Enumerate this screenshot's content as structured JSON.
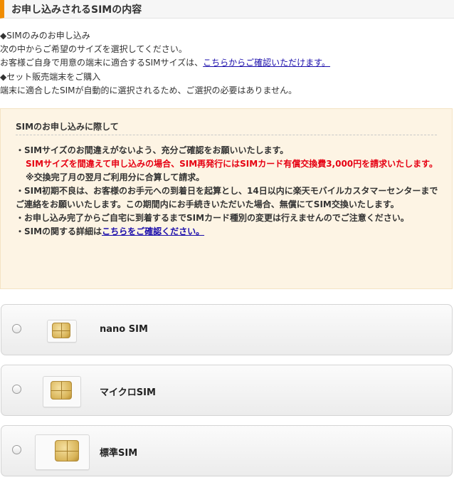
{
  "section_title": "お申し込みされるSIMの内容",
  "intro": {
    "line1": "◆SIMのみのお申し込み",
    "line2": "次の中からご希望のサイズを選択してください。",
    "line3_text": "お客様ご自身で用意の端末に適合するSIMサイズは、",
    "line3_link": "こちらからご確認いただけます。",
    "line4": "◆セット販売端末をご購入",
    "line5": "端末に適合したSIMが自動的に選択されるため、ご選択の必要はありません。"
  },
  "notice": {
    "title": "SIMのお申し込みに際して",
    "item1": "・SIMサイズのお間違えがないよう、充分ご確認をお願いいたします。",
    "item1_red": "SIMサイズを間違えて申し込みの場合、SIM再発行にはSIMカード有償交換費3,000円を請求いたします。",
    "item1_note": "※交換完了月の翌月ご利用分に合算して請求。",
    "item2": "・SIM初期不良は、お客様のお手元への到着日を起算とし、14日以内に楽天モバイルカスタマーセンターまでご連絡をお願いいたします。この期間内にお手続きいただいた場合、無償にてSIM交換いたします。",
    "item3": "・お申し込み完了からご自宅に到着するまでSIMカード種別の変更は行えませんのでご注意ください。",
    "item4_text": "・SIMの関する詳細は",
    "item4_link": "こちらをご確認ください。"
  },
  "options": [
    {
      "label": "nano SIM",
      "icon": "nano-sim-card-icon"
    },
    {
      "label": "マイクロSIM",
      "icon": "micro-sim-card-icon"
    },
    {
      "label": "標準SIM",
      "icon": "standard-sim-card-icon"
    }
  ],
  "colors": {
    "accent_bar": "#f08c00",
    "notice_bg": "#fdf4e4",
    "warning_red": "#e60012",
    "link": "#1a0dab"
  }
}
